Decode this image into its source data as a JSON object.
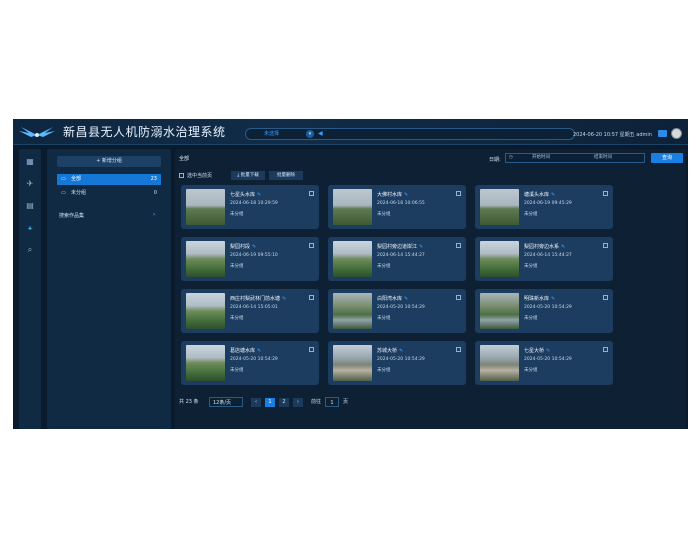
{
  "header": {
    "title": "新昌县无人机防溺水治理系统",
    "nav_select": "未选择",
    "datetime": "2024-06-20 10:57 星期五",
    "user": "admin"
  },
  "groups": {
    "add_label": "+ 新增分组",
    "items": [
      {
        "name": "全部",
        "count": "23",
        "active": true
      },
      {
        "name": "未分组",
        "count": "0",
        "active": false
      }
    ],
    "search_result_label": "搜索作品集"
  },
  "toolbar": {
    "all_label": "全部",
    "date_label": "日期:",
    "start_placeholder": "开始时间",
    "end_placeholder": "结束时间",
    "query_label": "查询",
    "select_page_label": "选中当前页",
    "download_label": "批量下载",
    "batch_delete_label": "批量删除"
  },
  "cards": [
    {
      "title": "七星头水库",
      "date": "2024-06-18 10:29:59",
      "group": "未分组",
      "scene": "sky"
    },
    {
      "title": "大佛村水库",
      "date": "2024-06-18 10:06:55",
      "group": "未分组",
      "scene": "sky"
    },
    {
      "title": "塘溪头水库",
      "date": "2024-06-19 09:45:29",
      "group": "未分组",
      "scene": "sky"
    },
    {
      "title": "梨园村段",
      "date": "2024-06-19 09:55:10",
      "group": "未分组",
      "scene": "hill"
    },
    {
      "title": "梨园村旁边道岸江",
      "date": "2024-06-14 15:44:27",
      "group": "未分组",
      "scene": "hill"
    },
    {
      "title": "梨园村旁边水系",
      "date": "2024-06-14 15:44:27",
      "group": "未分组",
      "scene": "hill"
    },
    {
      "title": "西庄村梨武林门前水塘",
      "date": "2024-06-14 15:05:01",
      "group": "未分组",
      "scene": "hill"
    },
    {
      "title": "白阳湾水库",
      "date": "2024-05-20 10:54:29",
      "group": "未分组",
      "scene": "river"
    },
    {
      "title": "明珠新水库",
      "date": "2024-05-20 10:54:29",
      "group": "未分组",
      "scene": "river"
    },
    {
      "title": "葛店塘水库",
      "date": "2024-05-20 10:54:29",
      "group": "未分组",
      "scene": "hill"
    },
    {
      "title": "苏城大桥",
      "date": "2024-05-20 10:54:29",
      "group": "未分组",
      "scene": "town"
    },
    {
      "title": "七星大桥",
      "date": "2024-05-20 10:54:29",
      "group": "未分组",
      "scene": "town"
    }
  ],
  "pagination": {
    "total": "共 23 条",
    "page_size": "12条/页",
    "prev": "‹",
    "pages": [
      "1",
      "2",
      "›"
    ],
    "active_page": "1",
    "goto_label": "前往",
    "goto_value": "1",
    "page_unit": "页"
  }
}
